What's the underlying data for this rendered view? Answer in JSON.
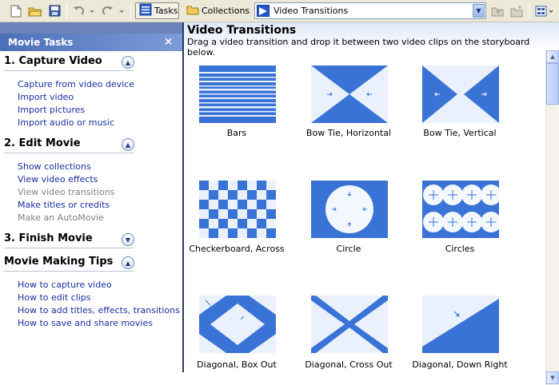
{
  "toolbar": {
    "tasks_label": "Tasks",
    "collections_label": "Collections",
    "combo_value": "Video Transitions",
    "icons": [
      "new-project-icon",
      "open-project-icon",
      "save-project-icon",
      "undo-icon",
      "redo-icon",
      "tasks-icon",
      "collections-folder-icon",
      "up-one-level-icon",
      "new-collection-folder-icon",
      "views-icon"
    ]
  },
  "left_panel": {
    "header": "Movie Tasks",
    "close_glyph": "×",
    "sections": [
      {
        "title": "1. Capture Video",
        "expanded": true,
        "links": [
          {
            "label": "Capture from video device",
            "enabled": true
          },
          {
            "label": "Import video",
            "enabled": true
          },
          {
            "label": "Import pictures",
            "enabled": true
          },
          {
            "label": "Import audio or music",
            "enabled": true
          }
        ]
      },
      {
        "title": "2. Edit Movie",
        "expanded": true,
        "links": [
          {
            "label": "Show collections",
            "enabled": true
          },
          {
            "label": "View video effects",
            "enabled": true
          },
          {
            "label": "View video transitions",
            "enabled": false
          },
          {
            "label": "Make titles or credits",
            "enabled": true
          },
          {
            "label": "Make an AutoMovie",
            "enabled": false
          }
        ]
      },
      {
        "title": "3. Finish Movie",
        "expanded": false,
        "links": []
      },
      {
        "title": "Movie Making Tips",
        "expanded": true,
        "links": [
          {
            "label": "How to capture video",
            "enabled": true
          },
          {
            "label": "How to edit clips",
            "enabled": true
          },
          {
            "label": "How to add titles, effects, transitions",
            "enabled": true
          },
          {
            "label": "How to save and share movies",
            "enabled": true
          }
        ]
      }
    ]
  },
  "right_panel": {
    "title": "Video Transitions",
    "subtitle": "Drag a video transition and drop it between two video clips on the storyboard below.",
    "transitions": [
      {
        "label": "Bars",
        "icon": "bars-transition-icon"
      },
      {
        "label": "Bow Tie, Horizontal",
        "icon": "bow-tie-horizontal-icon"
      },
      {
        "label": "Bow Tie, Vertical",
        "icon": "bow-tie-vertical-icon"
      },
      {
        "label": "Checkerboard, Across",
        "icon": "checkerboard-across-icon"
      },
      {
        "label": "Circle",
        "icon": "circle-transition-icon"
      },
      {
        "label": "Circles",
        "icon": "circles-transition-icon"
      },
      {
        "label": "Diagonal, Box Out",
        "icon": "diagonal-box-out-icon"
      },
      {
        "label": "Diagonal, Cross Out",
        "icon": "diagonal-cross-out-icon"
      },
      {
        "label": "Diagonal, Down Right",
        "icon": "diagonal-down-right-icon"
      }
    ]
  },
  "colors": {
    "toolbar_bg": "#ece9d8",
    "task_header": "#4b6fb8",
    "link": "#1a2ea0",
    "transition_blue": "#3a73d6"
  }
}
